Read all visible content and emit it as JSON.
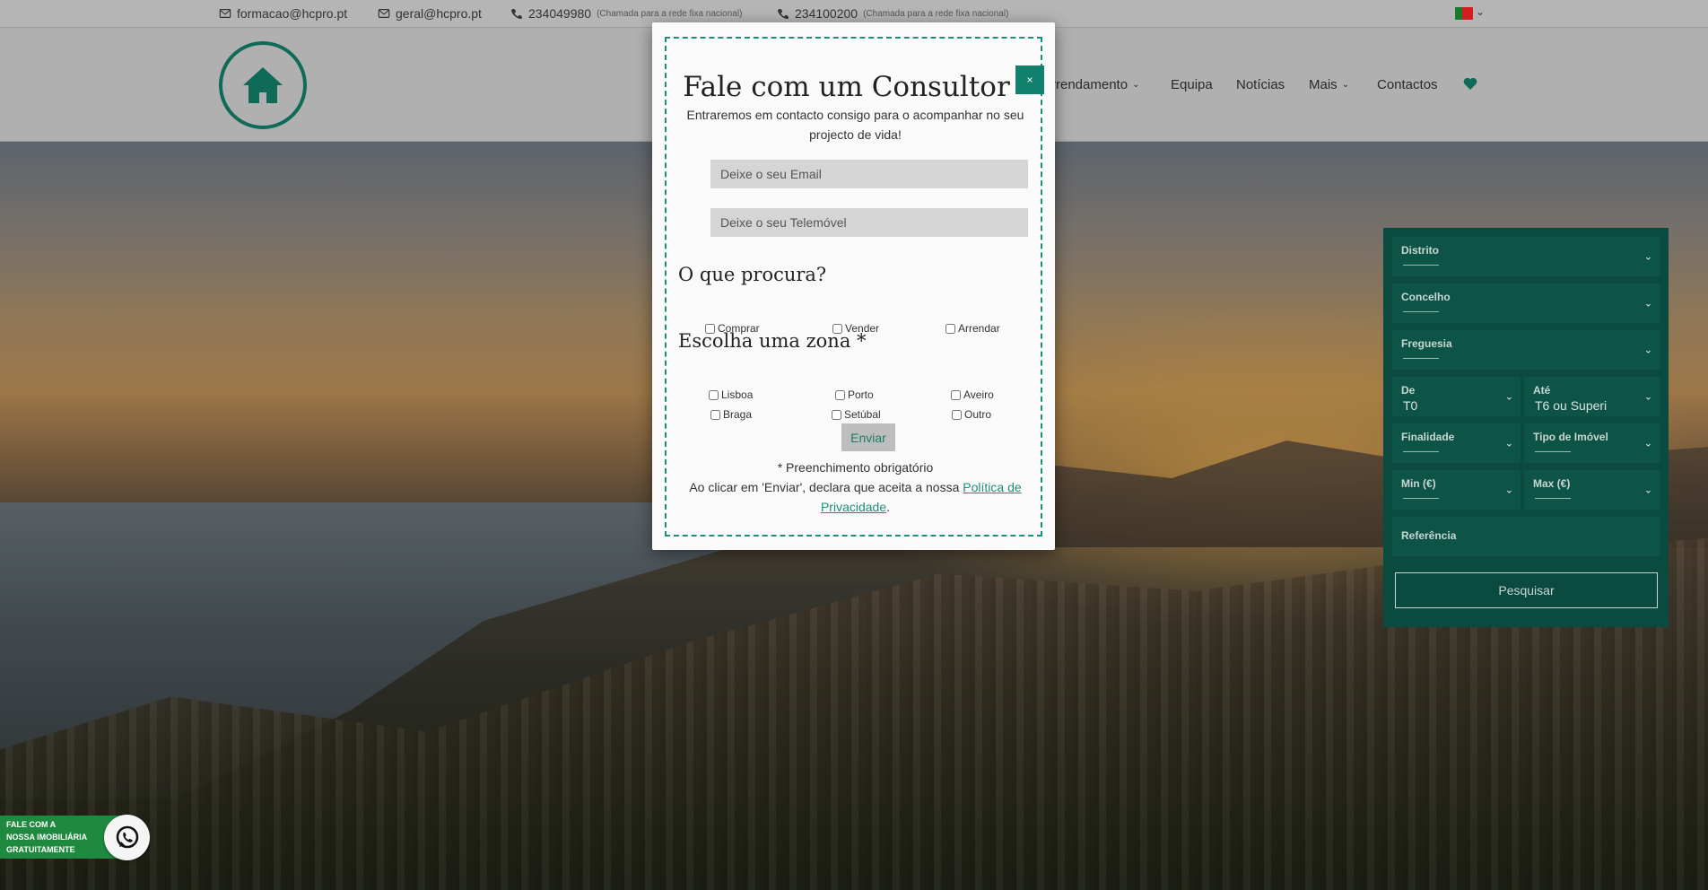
{
  "topbar": {
    "email1": "formacao@hcpro.pt",
    "email2": "geral@hcpro.pt",
    "phone1": "234049980",
    "phone1_note": "(Chamada para a rede fixa nacional)",
    "phone2": "234100200",
    "phone2_note": "(Chamada para a rede fixa nacional)"
  },
  "nav": {
    "items": [
      "Arrendamento",
      "Equipa",
      "Notícias",
      "Mais",
      "Contactos"
    ]
  },
  "modal": {
    "close_label": "×",
    "title": "Fale com um Consultor",
    "subtitle": "Entraremos em contacto consigo para o acompanhar no seu projecto de vida!",
    "email_placeholder": "Deixe o seu Email",
    "phone_placeholder": "Deixe o seu Telemóvel",
    "heading_search": "O que procura?",
    "options_search": [
      "Comprar",
      "Vender",
      "Arrendar"
    ],
    "heading_zone": "Escolha uma zona *",
    "zones": [
      "Lisboa",
      "Porto",
      "Aveiro",
      "Braga",
      "Setúbal",
      "Outro"
    ],
    "send_label": "Enviar",
    "required_note": "* Preenchimento obrigatório",
    "privacy_prefix": "Ao clicar em 'Enviar', declara que aceita a nossa ",
    "privacy_link": "Política de Privacidade",
    "privacy_suffix": "."
  },
  "search": {
    "distrito": "Distrito",
    "concelho": "Concelho",
    "freguesia": "Freguesia",
    "de_label": "De",
    "de_value": "T0",
    "ate_label": "Até",
    "ate_value": "T6 ou Superi",
    "finalidade": "Finalidade",
    "tipo": "Tipo de Imóvel",
    "min": "Min (€)",
    "max": "Max (€)",
    "referencia": "Referência",
    "button": "Pesquisar"
  },
  "whatsapp": {
    "line1": "FALE COM A",
    "line2": "NOSSA IMOBILIÁRIA",
    "line3": "GRATUITAMENTE"
  },
  "colors": {
    "brand": "#0f6a58",
    "accent": "#11806c",
    "panel": "#0b4a3e",
    "whatsapp": "#1f8a3f"
  }
}
